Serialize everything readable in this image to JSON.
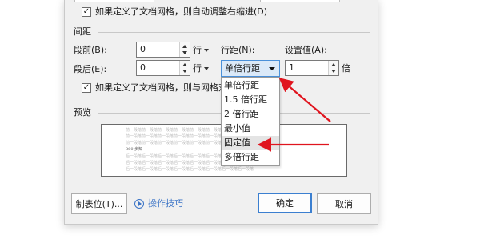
{
  "indent": {
    "auto_adjust_checkbox_label": "如果定义了文档网格，则自动调整右缩进(D)",
    "auto_adjust_checked": true
  },
  "spacing": {
    "section_title": "间距",
    "before_label": "段前(B):",
    "before_value": "0",
    "before_unit": "行",
    "after_label": "段后(E):",
    "after_value": "0",
    "after_unit": "行",
    "line_spacing_label": "行距(N):",
    "line_spacing_value": "单倍行距",
    "set_value_label": "设置值(A):",
    "set_value_value": "1",
    "set_value_unit": "倍",
    "snap_grid_checkbox_label": "如果定义了文档网格，则与网格对",
    "snap_grid_checked": true
  },
  "line_spacing_dropdown": {
    "options": [
      "单倍行距",
      "1.5 倍行距",
      "2 倍行距",
      "最小值",
      "固定值",
      "多倍行距"
    ],
    "highlighted": "固定值"
  },
  "preview": {
    "section_title": "预览",
    "filler_before": "前一段落前一段落前一段落前一段落前一段落前一段落前一段落前一段落",
    "sample_text": "360 步知",
    "filler_after": "后一段落后一段落后一段落后一段落后一段落后一段落后一段落后一段落"
  },
  "buttons": {
    "tabs_label": "制表位(T)...",
    "tips_label": "操作技巧",
    "ok_label": "确定",
    "cancel_label": "取消"
  },
  "colors": {
    "dialog_bg": "#f0f0f0",
    "accent_blue": "#3b7fd0",
    "combo_highlight": "#dbe9f8",
    "annotation_arrow": "#e0141e",
    "link": "#3a73c6"
  }
}
